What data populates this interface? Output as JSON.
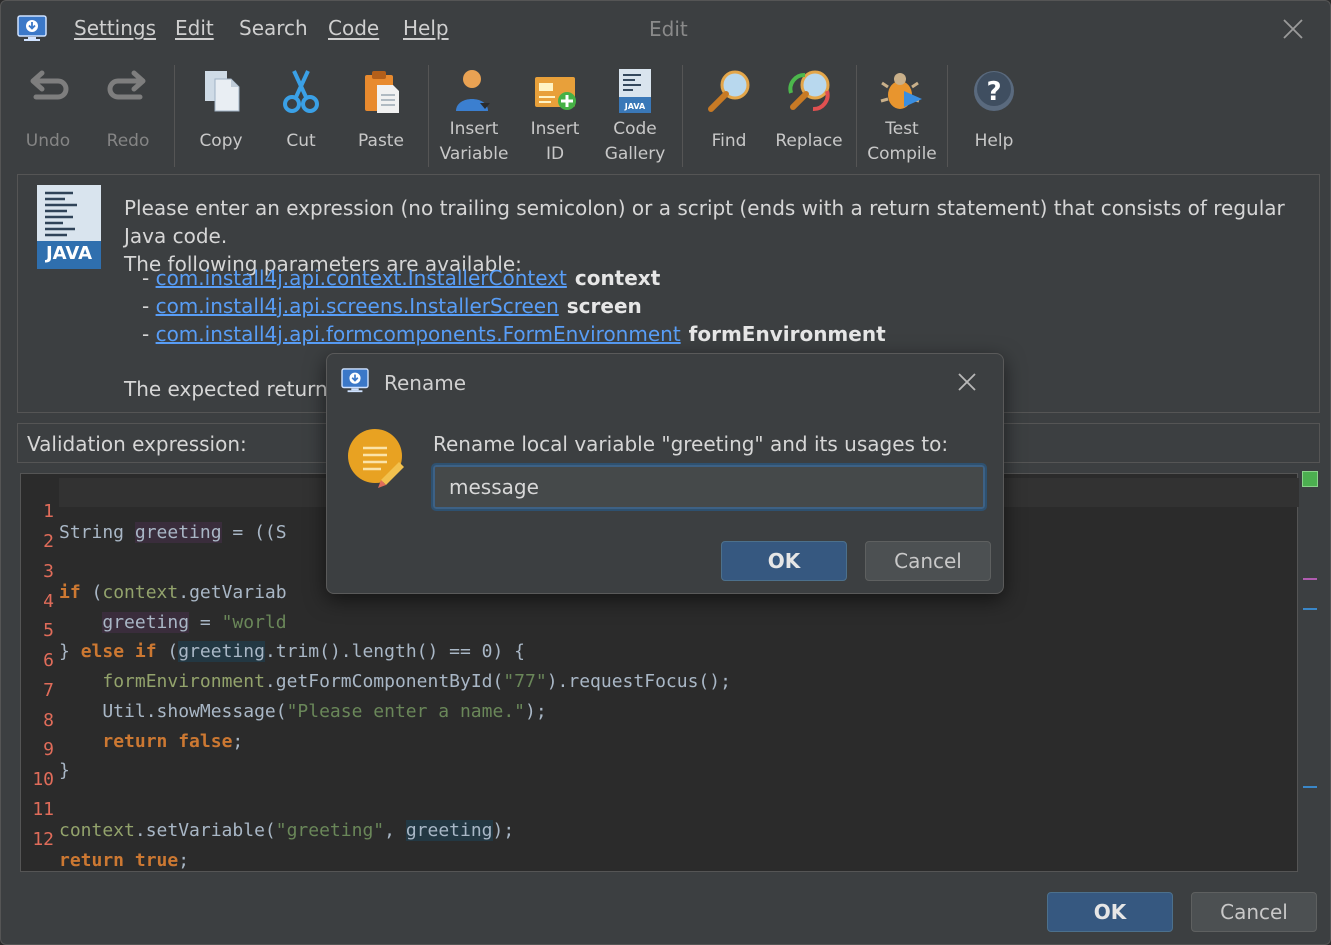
{
  "window": {
    "title": "Edit"
  },
  "menu": [
    "Settings",
    "Edit",
    "Search",
    "Code",
    "Help"
  ],
  "toolbar": {
    "undo": "Undo",
    "redo": "Redo",
    "copy": "Copy",
    "cut": "Cut",
    "paste": "Paste",
    "insert_variable": [
      "Insert",
      "Variable"
    ],
    "insert_id": [
      "Insert",
      "ID"
    ],
    "code_gallery": [
      "Code",
      "Gallery"
    ],
    "find": "Find",
    "replace": "Replace",
    "test_compile": [
      "Test",
      "Compile"
    ],
    "help": "Help"
  },
  "info": {
    "logo_text": "JAVA",
    "line1": "Please enter an expression (no trailing semicolon) or a script (ends with a return statement) that consists of regular Java code.",
    "line2": "The following parameters are available:",
    "params": [
      {
        "type": "com.install4j.api.context.InstallerContext",
        "name": "context"
      },
      {
        "type": "com.install4j.api.screens.InstallerScreen",
        "name": "screen"
      },
      {
        "type": "com.install4j.api.formcomponents.FormEnvironment",
        "name": "formEnvironment"
      }
    ],
    "expected": "The expected return type"
  },
  "validation_label": "Validation expression:",
  "code_lines": [
    "1",
    "2",
    "3",
    "4",
    "5",
    "6",
    "7",
    "8",
    "9",
    "10",
    "11",
    "12"
  ],
  "code": {
    "l1_a": "String ",
    "l1_b": "greeting",
    "l1_c": " = ((S",
    "l3_a": "if",
    "l3_b": " (",
    "l3_c": "context",
    "l3_d": ".getVariab",
    "l4_a": "    ",
    "l4_b": "greeting",
    "l4_c": " = ",
    "l4_d": "\"world",
    "l5_a": "} ",
    "l5_b": "else if",
    "l5_c": " (",
    "l5_d": "greeting",
    "l5_e": ".trim().length() == 0) {",
    "l6_a": "    ",
    "l6_b": "formEnvironment",
    "l6_c": ".getFormComponentById(",
    "l6_d": "\"77\"",
    "l6_e": ").requestFocus();",
    "l7_a": "    Util.showMessage(",
    "l7_b": "\"Please enter a name.\"",
    "l7_c": ");",
    "l8_a": "    ",
    "l8_b": "return false",
    "l8_c": ";",
    "l9": "}",
    "l11_a": "context",
    "l11_b": ".setVariable(",
    "l11_c": "\"greeting\"",
    "l11_d": ", ",
    "l11_e": "greeting",
    "l11_f": ");",
    "l12_a": "return true",
    "l12_b": ";"
  },
  "buttons": {
    "ok": "OK",
    "cancel": "Cancel"
  },
  "rename_dialog": {
    "title": "Rename",
    "message": "Rename local variable \"greeting\" and its usages to:",
    "value": "message",
    "ok": "OK",
    "cancel": "Cancel"
  },
  "colors": {
    "background": "#3c3f41",
    "editor": "#2b2b2b",
    "primary_button": "#365880",
    "link": "#589df6",
    "keyword": "#cc7832",
    "string": "#6a8759",
    "line_number": "#e06c5a"
  },
  "icons": [
    "app-monitor-icon",
    "undo-icon",
    "redo-icon",
    "copy-icon",
    "cut-icon",
    "paste-icon",
    "insert-variable-icon",
    "insert-id-icon",
    "code-gallery-icon",
    "find-icon",
    "replace-icon",
    "test-compile-icon",
    "help-icon",
    "java-logo-icon",
    "notepad-icon",
    "close-icon"
  ]
}
